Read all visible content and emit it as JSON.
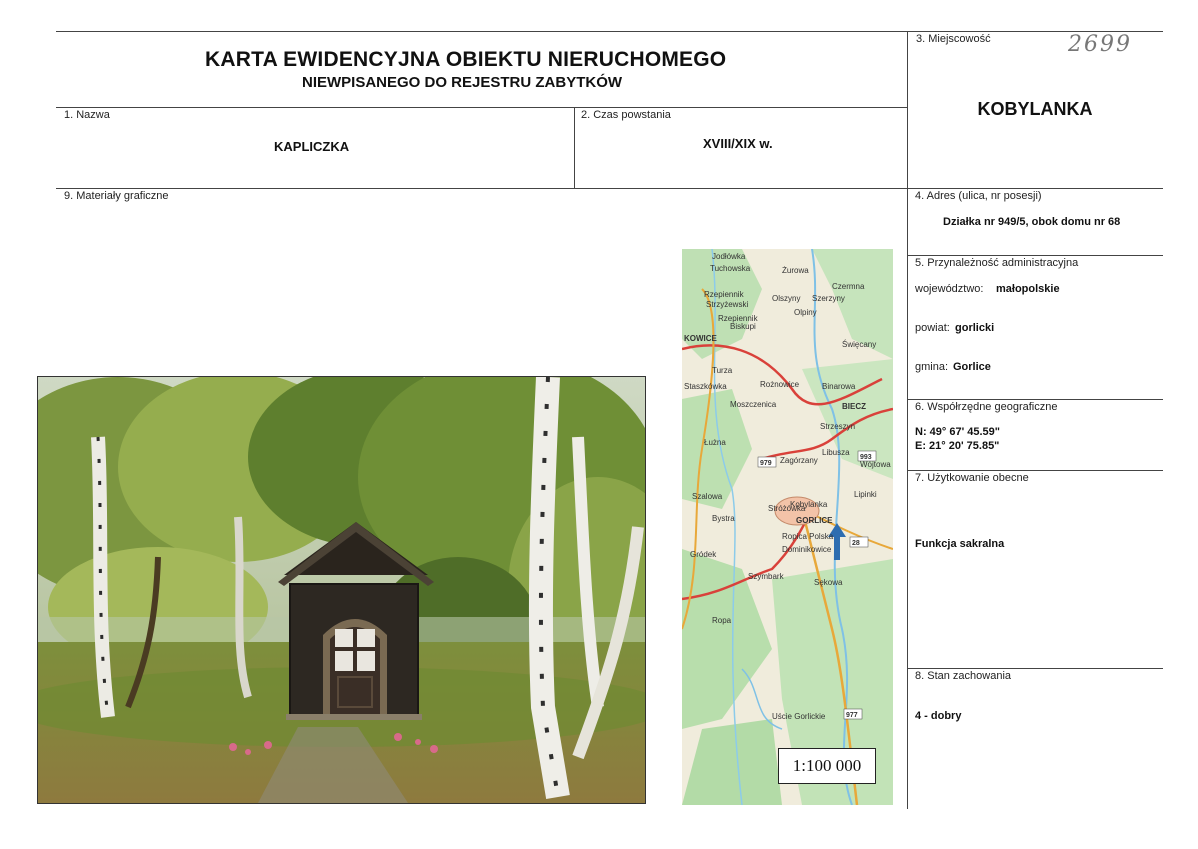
{
  "header": {
    "title_line1": "KARTA EWIDENCYJNA OBIEKTU NIERUCHOMEGO",
    "title_line2": "NIEWPISANEGO DO REJESTRU ZABYTKÓW",
    "handwritten_number": "2699"
  },
  "fields": {
    "nazwa": {
      "label": "1. Nazwa",
      "value": "KAPLICZKA"
    },
    "czas": {
      "label": "2. Czas powstania",
      "value": "XVIII/XIX w."
    },
    "miejscowosc": {
      "label": "3. Miejscowość",
      "value": "KOBYLANKA"
    },
    "adres": {
      "label": "4. Adres (ulica, nr posesji)",
      "value": "Działka nr 949/5, obok domu nr 68"
    },
    "przynaleznosc": {
      "label": "5. Przynależność administracyjna",
      "wojewodztwo_label": "województwo:",
      "wojewodztwo": "małopolskie",
      "powiat_label": "powiat:",
      "powiat": "gorlicki",
      "gmina_label": "gmina:",
      "gmina": "Gorlice"
    },
    "wspolrzedne": {
      "label": "6. Współrzędne geograficzne",
      "n": "N: 49° 67' 45.59\"",
      "e": "E: 21° 20' 75.85\""
    },
    "uzytkowanie": {
      "label": "7. Użytkowanie obecne",
      "value": "Funkcja sakralna"
    },
    "stan": {
      "label": "8. Stan zachowania",
      "value": "4 - dobry"
    },
    "materialy": {
      "label": "9. Materiały graficzne"
    }
  },
  "map": {
    "scale": "1:100 000",
    "labels": [
      "Jodłówka",
      "Tuchowska",
      "Żurowa",
      "Czermna",
      "Rzepiennik",
      "Strzyżewski",
      "Olszyny",
      "Szerzyny",
      "Rzepiennik",
      "Biskupi",
      "Olpiny",
      "KOWICE",
      "Turza",
      "Święcany",
      "Staszkówka",
      "Rożnowice",
      "Binarowa",
      "BIECZ",
      "Moszczenica",
      "Strzeszyn",
      "Łużna",
      "Libusza",
      "Zagórzany",
      "Wójtowa",
      "Szalowa",
      "Lipinki",
      "Bystra",
      "Stróżówka",
      "Kobylanka",
      "GORLICE",
      "Ropica Polska",
      "Dominikowice",
      "Gródek",
      "Szymbark",
      "Sękowa",
      "Ropa",
      "Uście Gorlickie",
      "1:100 000"
    ],
    "road_numbers": [
      "979",
      "28",
      "993",
      "977"
    ]
  },
  "photo": {
    "alt": "Wooden chapel among birch trees"
  }
}
